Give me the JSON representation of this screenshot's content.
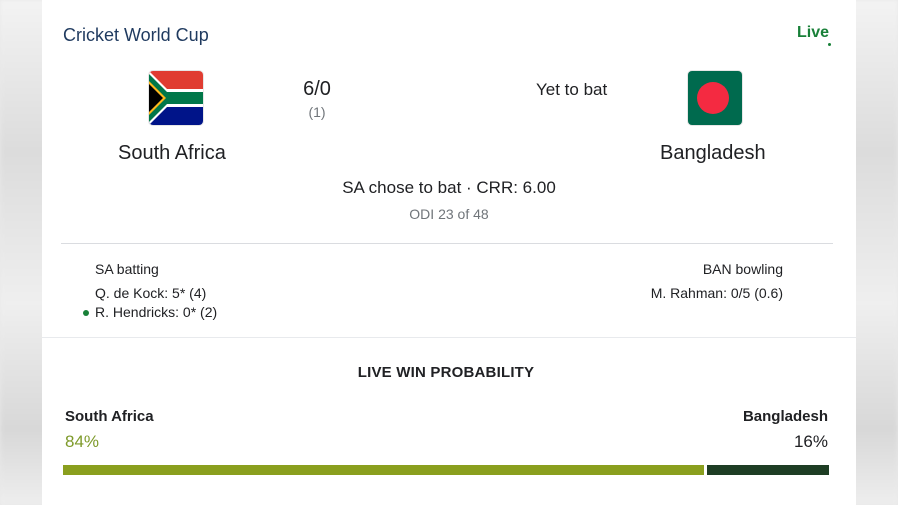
{
  "header": {
    "title": "Cricket World Cup",
    "live_label": "Live"
  },
  "teams": {
    "home": {
      "name": "South Africa",
      "flag_icon": "south-africa-flag-icon",
      "score": "6/0",
      "overs": "(1)"
    },
    "away": {
      "name": "Bangladesh",
      "flag_icon": "bangladesh-flag-icon",
      "status": "Yet to bat"
    }
  },
  "match": {
    "status": "SA chose to bat · CRR: 6.00",
    "info": "ODI 23 of 48"
  },
  "batting": {
    "heading": "SA batting",
    "players": [
      "Q. de Kock: 5* (4)",
      "R. Hendricks: 0* (2)"
    ]
  },
  "bowling": {
    "heading": "BAN bowling",
    "players": [
      "M. Rahman: 0/5 (0.6)"
    ]
  },
  "win_probability": {
    "title": "LIVE WIN PROBABILITY",
    "home": {
      "name": "South Africa",
      "percent_label": "84%",
      "value": 84,
      "color": "#8a9f1e"
    },
    "away": {
      "name": "Bangladesh",
      "percent_label": "16%",
      "value": 16,
      "color": "#1e3d24"
    }
  },
  "colors": {
    "live": "#188038",
    "title": "#1f3a5f"
  }
}
